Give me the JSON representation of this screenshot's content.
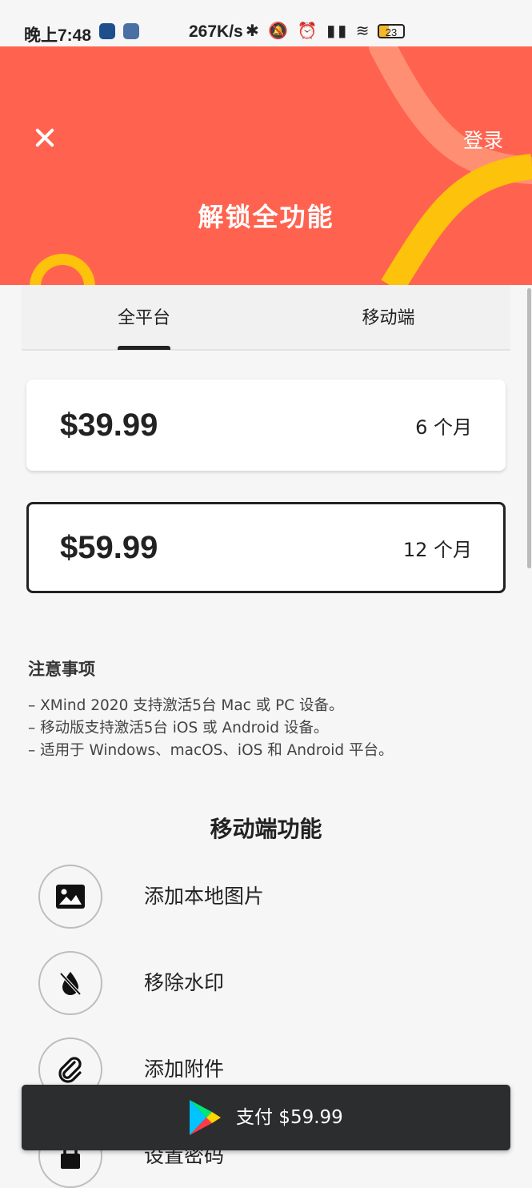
{
  "status_bar": {
    "time": "晚上7:48",
    "net_speed": "267K/s",
    "battery": "23"
  },
  "header": {
    "title": "解锁全功能",
    "login_label": "登录",
    "colors": {
      "background": "#ff634f",
      "accent_yellow": "#fcc20c",
      "accent_pink": "#ff8f73"
    }
  },
  "tabs": [
    {
      "label": "全平台",
      "selected": true
    },
    {
      "label": "移动端",
      "selected": false
    }
  ],
  "plans": [
    {
      "price": "$39.99",
      "period": "6 个月",
      "selected": false
    },
    {
      "price": "$59.99",
      "period": "12 个月",
      "selected": true
    }
  ],
  "notes": {
    "title": "注意事项",
    "lines": [
      "– XMind 2020 支持激活5台 Mac 或 PC 设备。",
      "– 移动版支持激活5台 iOS 或 Android 设备。",
      "– 适用于 Windows、macOS、iOS 和 Android 平台。"
    ]
  },
  "features": {
    "title": "移动端功能",
    "items": [
      {
        "label": "添加本地图片",
        "icon": "image-icon"
      },
      {
        "label": "移除水印",
        "icon": "watermark-off-icon"
      },
      {
        "label": "添加附件",
        "icon": "paperclip-icon"
      },
      {
        "label": "设置密码",
        "icon": "lock-icon"
      }
    ]
  },
  "pay_button": {
    "label": "支付 $59.99",
    "icon": "google-play-icon"
  }
}
